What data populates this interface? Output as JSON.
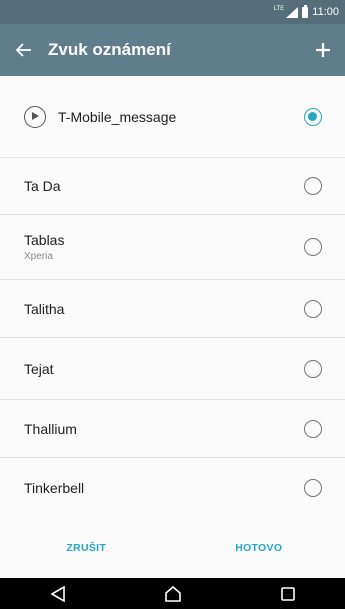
{
  "status_bar": {
    "network": "LTE",
    "time": "11:00"
  },
  "app_bar": {
    "back_icon": "arrow-left-icon",
    "title": "Zvuk oznámení",
    "add_icon": "plus-icon"
  },
  "sounds": [
    {
      "label": "T-Mobile_message",
      "subtitle": "",
      "selected": true
    },
    {
      "label": "Ta Da",
      "subtitle": "",
      "selected": false
    },
    {
      "label": "Tablas",
      "subtitle": "Xperia",
      "selected": false
    },
    {
      "label": "Talitha",
      "subtitle": "",
      "selected": false
    },
    {
      "label": "Tejat",
      "subtitle": "",
      "selected": false
    },
    {
      "label": "Thallium",
      "subtitle": "",
      "selected": false
    },
    {
      "label": "Tinkerbell",
      "subtitle": "",
      "selected": false
    }
  ],
  "actions": {
    "cancel_label": "ZRUŠIT",
    "done_label": "HOTOVO"
  },
  "nav": {
    "back_icon": "triangle-back-icon",
    "home_icon": "home-icon",
    "recents_icon": "square-recents-icon"
  },
  "colors": {
    "status_bar": "#546e7a",
    "app_bar": "#607d8b",
    "accent": "#26a5c6"
  }
}
